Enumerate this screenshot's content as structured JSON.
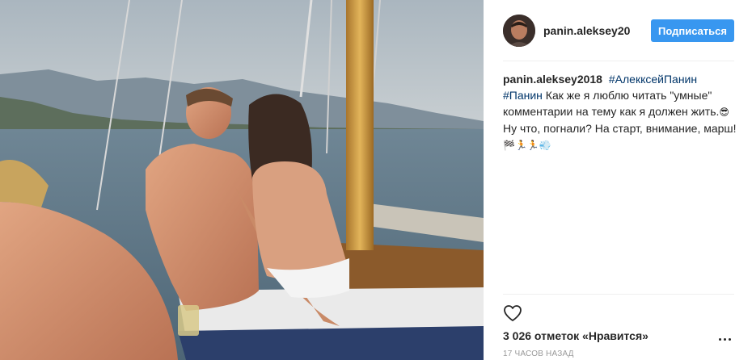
{
  "post": {
    "author": "panin.aleksey20",
    "follow_label": "Подписаться",
    "caption": {
      "author": "panin.aleksey2018",
      "tag1": "#АлекксейПанин",
      "tag2": "#Панин",
      "text_line1": " Как же я люблю читать \"умные\" комментарии на тему как я должен жить.",
      "emoji1": "😎",
      "text_line2": " Ну что, погнали? На старт, внимание, марш! ",
      "emoji2": "🏁🏃🏃💨"
    },
    "likes_text": "3 026 отметок «Нравится»",
    "time_text": "17 часов назад"
  },
  "icons": {
    "like": "heart-outline-icon",
    "more": "more-options-icon",
    "avatar": "profile-photo"
  },
  "colors": {
    "accent": "#3897f0",
    "hashtag": "#003569",
    "text": "#262626",
    "muted": "#999999"
  }
}
